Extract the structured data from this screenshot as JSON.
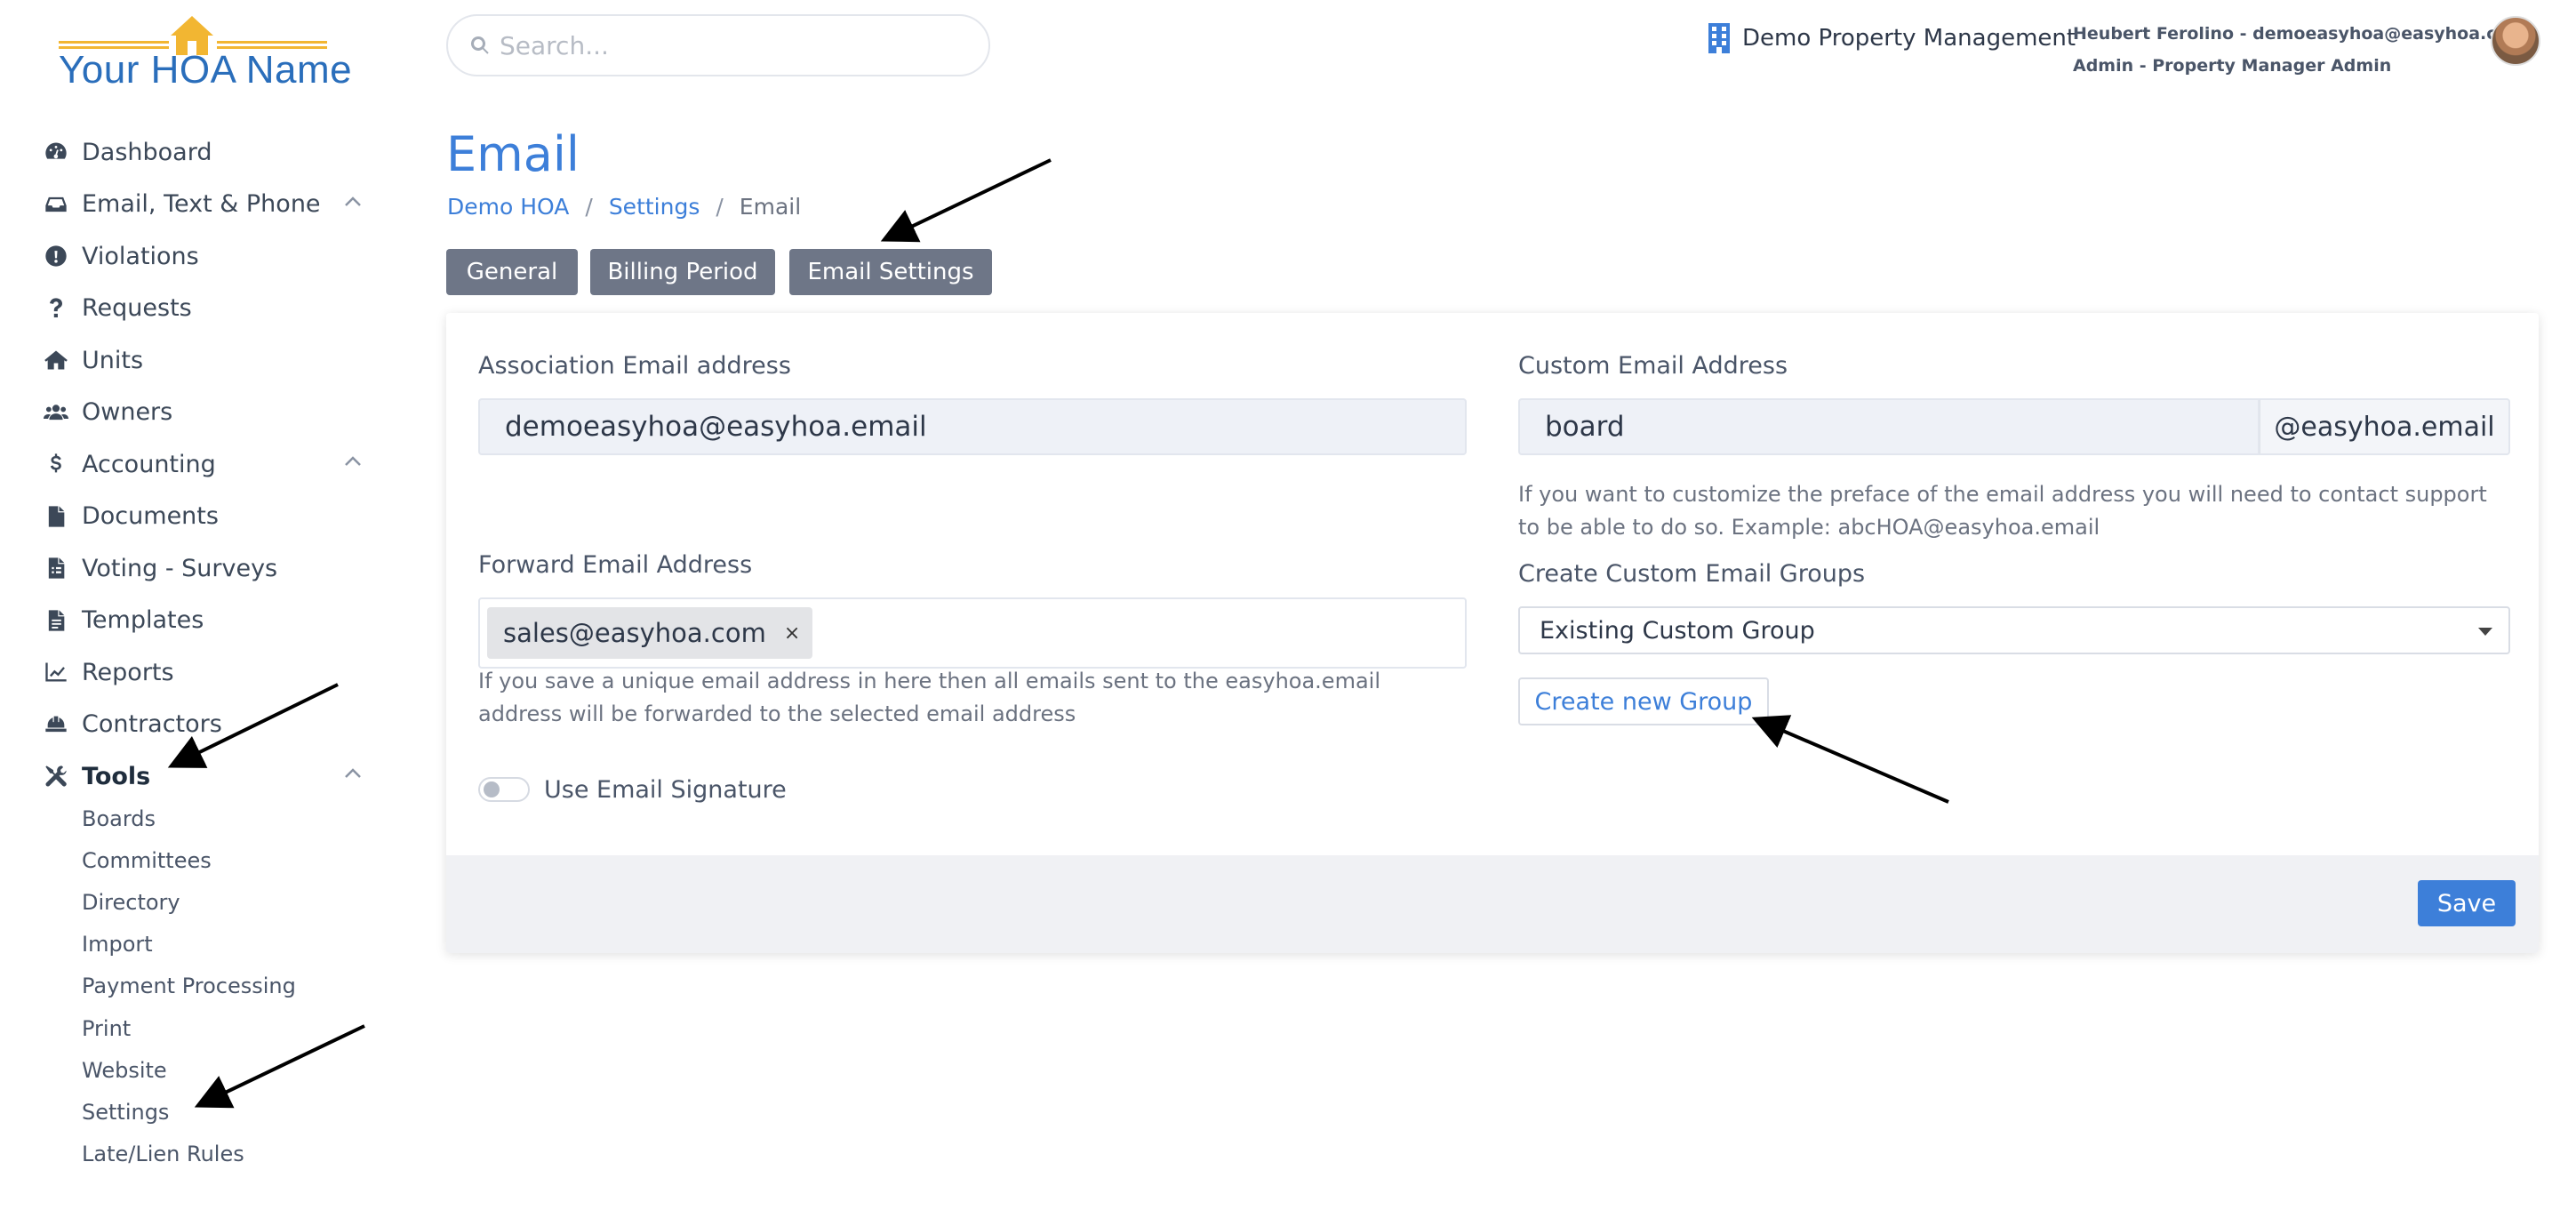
{
  "logo": {
    "text": "Your HOA Name"
  },
  "search": {
    "placeholder": "Search..."
  },
  "header": {
    "org_name": "Demo Property Management",
    "user_line1": "Heubert Ferolino - demoeasyhoa@easyhoa.com",
    "user_line2": "Admin - Property Manager Admin"
  },
  "sidebar": {
    "items": [
      {
        "label": "Dashboard",
        "icon": "dashboard-icon"
      },
      {
        "label": "Email, Text & Phone",
        "icon": "inbox-icon",
        "expandable": true
      },
      {
        "label": "Violations",
        "icon": "exclamation-icon"
      },
      {
        "label": "Requests",
        "icon": "question-icon"
      },
      {
        "label": "Units",
        "icon": "home-icon"
      },
      {
        "label": "Owners",
        "icon": "users-icon"
      },
      {
        "label": "Accounting",
        "icon": "dollar-icon",
        "expandable": true
      },
      {
        "label": "Documents",
        "icon": "file-icon"
      },
      {
        "label": "Voting - Surveys",
        "icon": "file-vote-icon"
      },
      {
        "label": "Templates",
        "icon": "file-text-icon"
      },
      {
        "label": "Reports",
        "icon": "chart-line-icon"
      },
      {
        "label": "Contractors",
        "icon": "hardhat-icon"
      },
      {
        "label": "Tools",
        "icon": "tools-icon",
        "expandable": true,
        "active": true
      }
    ],
    "sub_items": [
      "Boards",
      "Committees",
      "Directory",
      "Import",
      "Payment Processing",
      "Print",
      "Website",
      "Settings",
      "Late/Lien Rules"
    ]
  },
  "page": {
    "title": "Email",
    "breadcrumb": [
      "Demo HOA",
      "Settings",
      "Email"
    ],
    "tabs": [
      "General",
      "Billing Period",
      "Email Settings"
    ]
  },
  "form": {
    "association_email_label": "Association Email address",
    "association_email_value": "demoeasyhoa@easyhoa.email",
    "custom_email_label": "Custom Email Address",
    "custom_email_value": "board",
    "custom_email_suffix": "@easyhoa.email",
    "custom_email_help": "If you want to customize the preface of the email address you will need to contact support to be able to do so. Example: abcHOA@easyhoa.email",
    "forward_email_label": "Forward Email Address",
    "forward_email_tag": "sales@easyhoa.com",
    "forward_email_help": "If you save a unique email address in here then all emails sent to the easyhoa.email address will be forwarded to the selected email address",
    "signature_label": "Use Email Signature",
    "signature_enabled": false,
    "groups_label": "Create Custom Email Groups",
    "groups_selected": "Existing Custom Group",
    "create_group_button": "Create new Group",
    "save_button": "Save"
  },
  "colors": {
    "accent": "#3d7fd9",
    "tab_bg": "#6e7687",
    "logo_gold": "#f2b632",
    "logo_blue": "#2a6ebb"
  }
}
